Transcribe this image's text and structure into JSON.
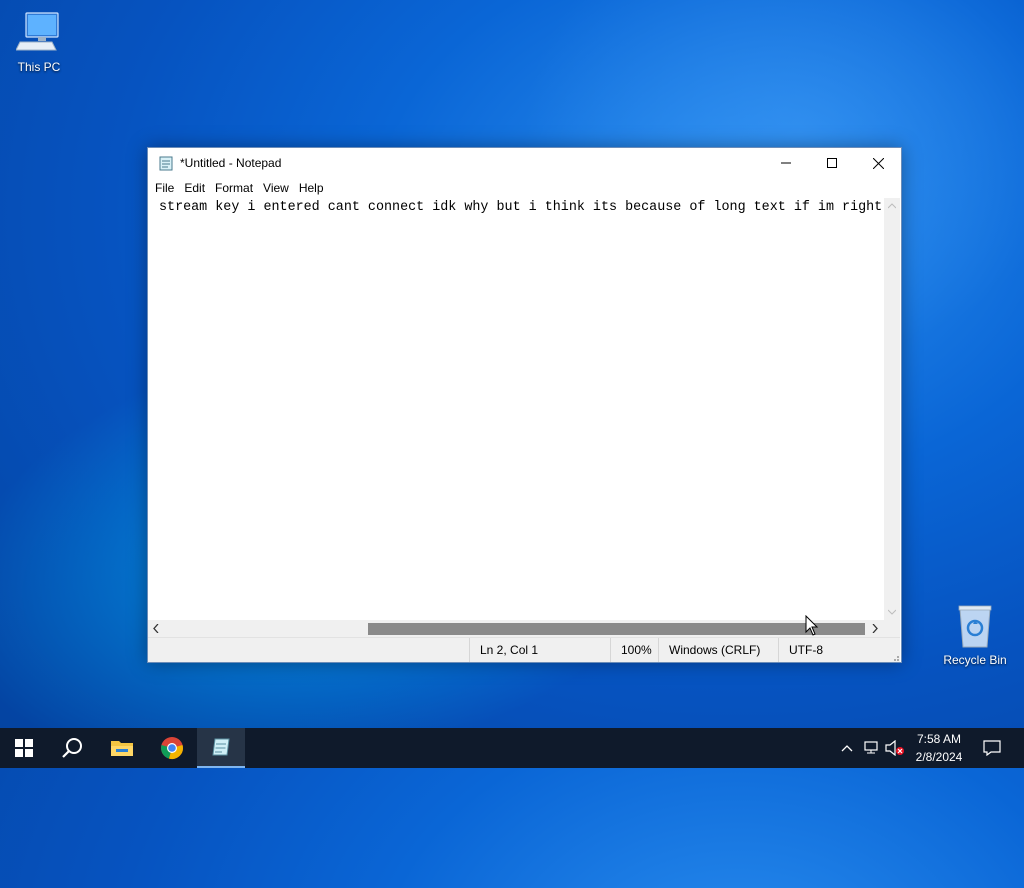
{
  "desktop": {
    "icons": [
      {
        "label": "This PC",
        "icon": "computer-icon"
      },
      {
        "label": "Recycle Bin",
        "icon": "recycle-bin-icon"
      }
    ]
  },
  "notepad": {
    "title": "*Untitled - Notepad",
    "menu": [
      "File",
      "Edit",
      "Format",
      "View",
      "Help"
    ],
    "content_line1": "stream key i entered cant connect idk why but i think its because of long text if im right",
    "status": {
      "position": "Ln 2, Col 1",
      "zoom": "100%",
      "line_ending": "Windows (CRLF)",
      "encoding": "UTF-8"
    }
  },
  "taskbar": {
    "apps": [
      "start-icon",
      "search-icon",
      "file-explorer-icon",
      "chrome-icon",
      "notepad-icon"
    ],
    "clock": {
      "time": "7:58 AM",
      "date": "2/8/2024"
    }
  },
  "colors": {
    "taskbar_bg": "#0f1a2b",
    "desktop_blue": "#0a66d6",
    "accent": "#7fb6f0"
  }
}
